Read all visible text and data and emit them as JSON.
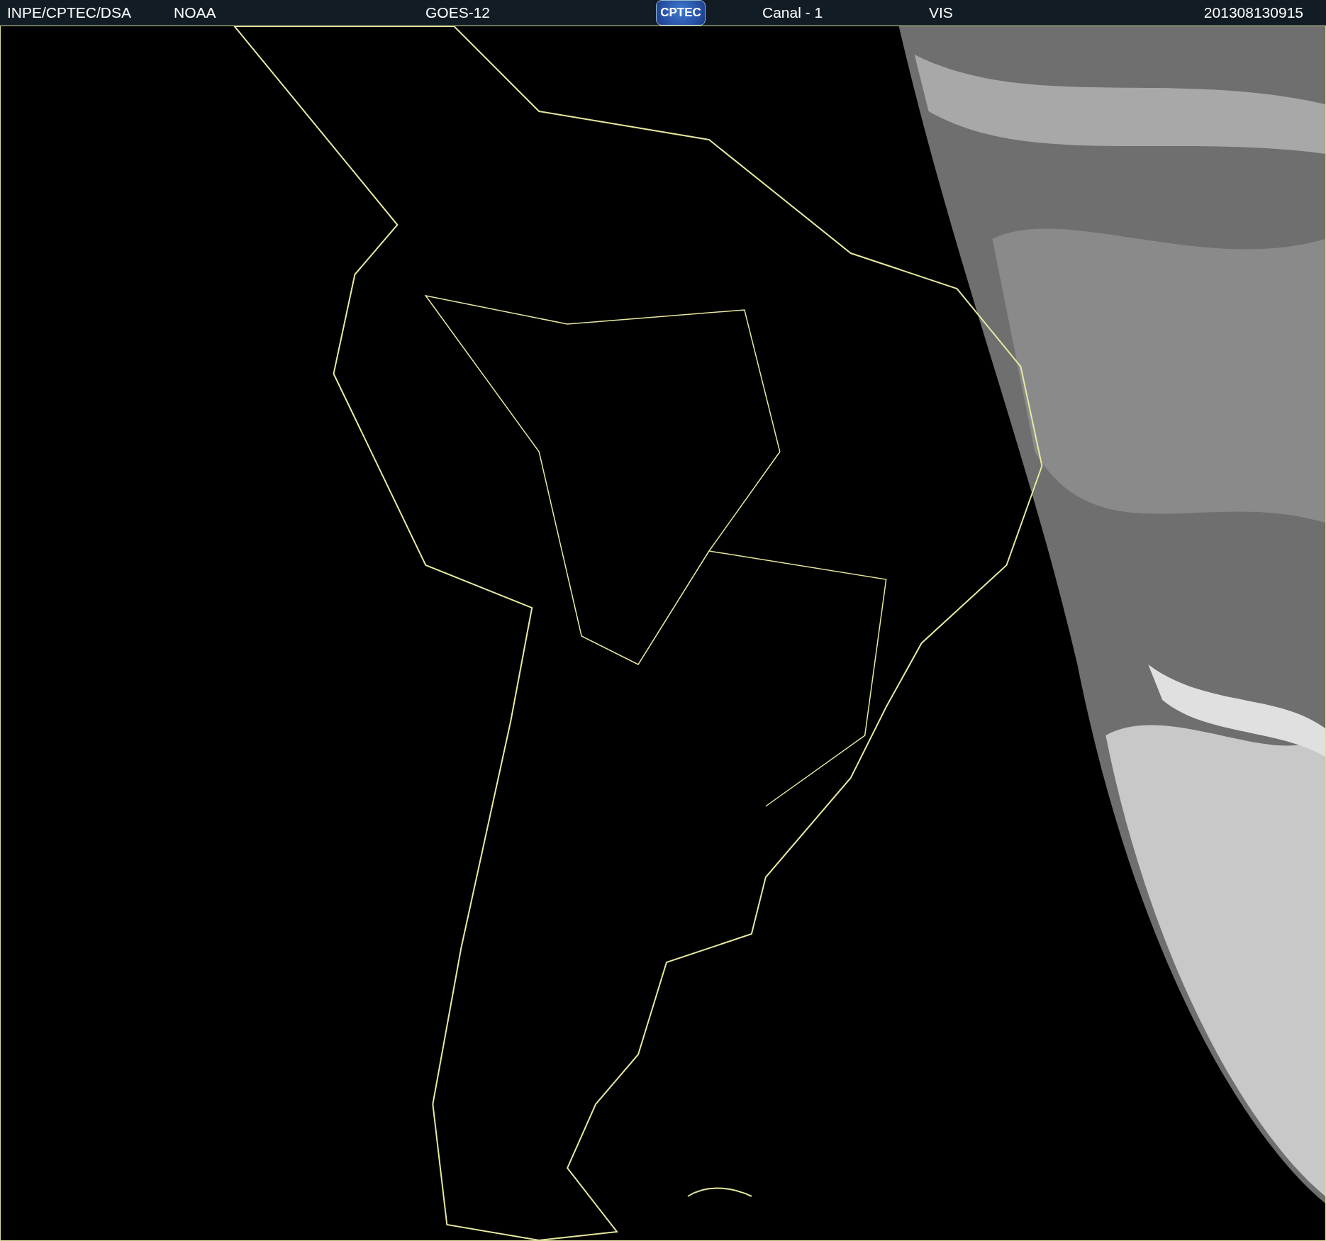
{
  "header": {
    "labels": [
      {
        "text": "INPE/CPTEC/DSA",
        "kind": "text"
      },
      {
        "text": "NOAA",
        "kind": "text"
      },
      {
        "text": "GOES-12",
        "kind": "text"
      },
      {
        "text": "CPTEC",
        "kind": "logo"
      },
      {
        "text": "Canal - 1",
        "kind": "text"
      },
      {
        "text": "VIS",
        "kind": "text"
      },
      {
        "text": "201308130915",
        "kind": "text"
      }
    ]
  }
}
